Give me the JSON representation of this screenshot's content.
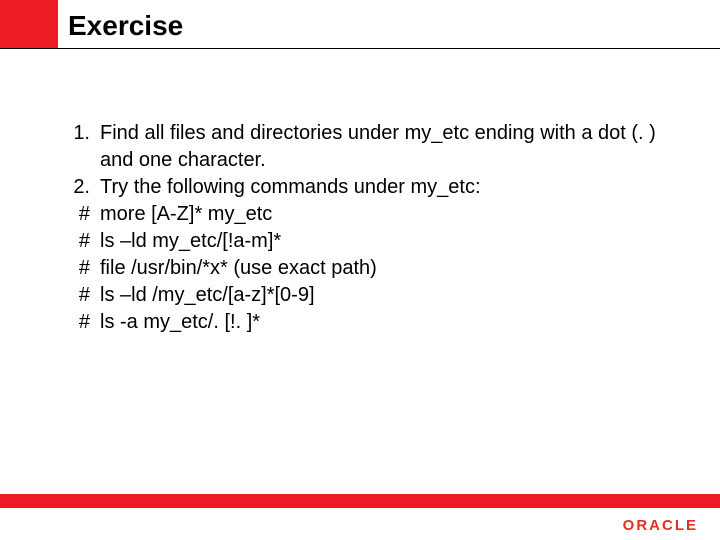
{
  "title": "Exercise",
  "items": [
    {
      "marker": "1.",
      "text": "Find all files and directories under my_etc ending with a dot (. ) and one character."
    },
    {
      "marker": "2.",
      "text": "Try the following commands under my_etc:"
    },
    {
      "marker": "#",
      "text": "more [A-Z]*   my_etc"
    },
    {
      "marker": "#",
      "text": "ls –ld   my_etc/[!a-m]*"
    },
    {
      "marker": "#",
      "text": "file   /usr/bin/*x*       (use exact path)"
    },
    {
      "marker": "#",
      "text": "ls –ld    /my_etc/[a-z]*[0-9]"
    },
    {
      "marker": "#",
      "text": "ls  -a    my_etc/. [!. ]*"
    }
  ],
  "logo": "ORACLE"
}
